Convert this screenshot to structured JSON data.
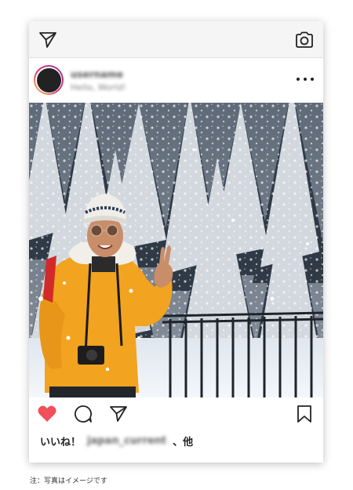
{
  "topbar": {
    "left_icon": "send-icon",
    "right_icon": "camera-icon"
  },
  "post": {
    "username": "username",
    "subtitle": "Hello, World!",
    "more_icon": "more-horizontal-icon",
    "photo_alt": "Woman in orange jacket making peace sign in snowy forest"
  },
  "actions": {
    "like_icon": "heart-icon",
    "like_color": "#f0505a",
    "comment_icon": "comment-icon",
    "share_icon": "send-icon",
    "bookmark_icon": "bookmark-icon"
  },
  "likes": {
    "prefix": "いいね！",
    "account": "japan_current",
    "suffix": "、他"
  },
  "note": "注：写真はイメージです"
}
